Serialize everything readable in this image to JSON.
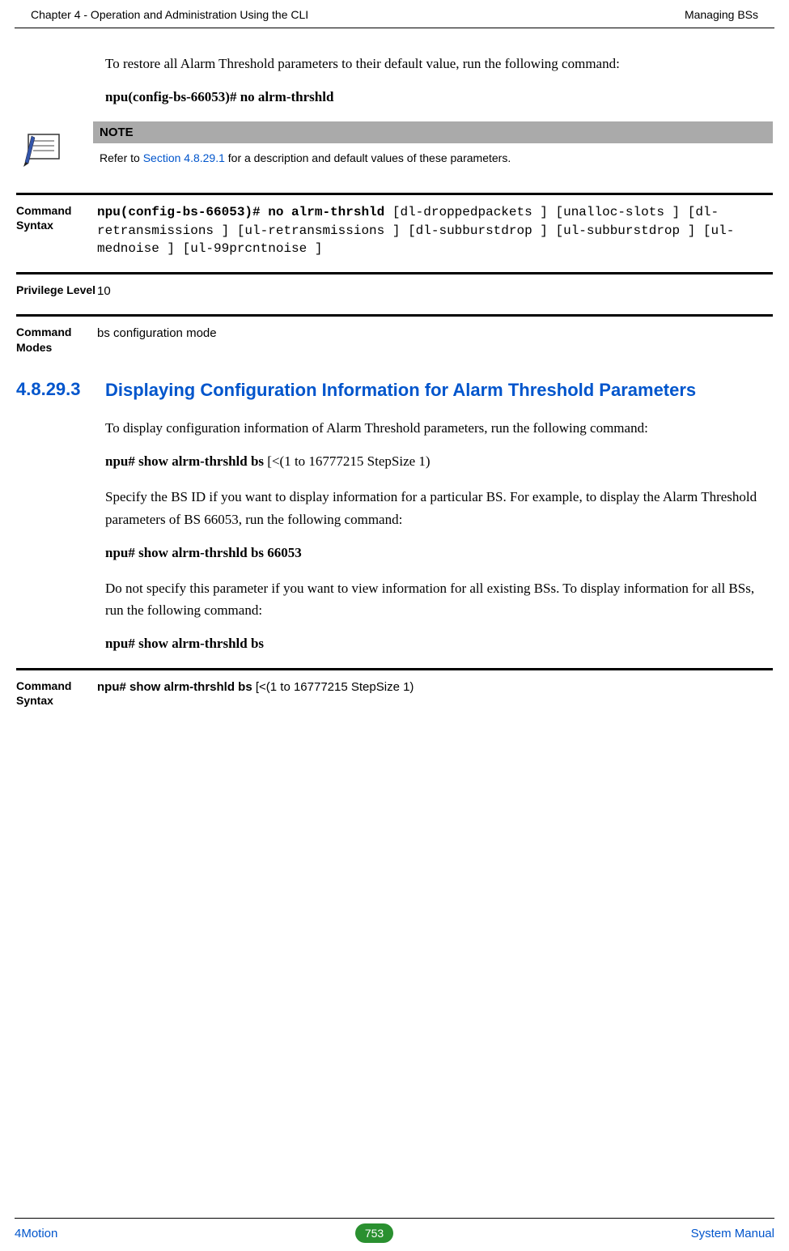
{
  "header": {
    "left": "Chapter 4 - Operation and Administration Using the CLI",
    "right": "Managing BSs"
  },
  "intro": {
    "text": "To restore all Alarm Threshold parameters to their default value, run the following command:",
    "command": "npu(config-bs-66053)# no alrm-thrshld"
  },
  "note": {
    "label": "NOTE",
    "prefix": "Refer to ",
    "link": "Section 4.8.29.1",
    "suffix": " for a description and default values of these parameters."
  },
  "row1": {
    "label": "Command Syntax",
    "bold": "npu(config-bs-66053)# no alrm-thrshld",
    "rest": " [dl-droppedpackets ] [unalloc-slots ] [dl-retransmissions ] [ul-retransmissions ] [dl-subburstdrop ] [ul-subburstdrop ] [ul-mednoise ] [ul-99prcntnoise ]"
  },
  "row2": {
    "label": "Privilege Level",
    "value": "10"
  },
  "row3": {
    "label": "Command Modes",
    "value": "bs configuration mode"
  },
  "section": {
    "num": "4.8.29.3",
    "title": "Displaying Configuration Information for Alarm Threshold Parameters"
  },
  "body": {
    "p1": "To display configuration information of Alarm Threshold parameters, run the following command:",
    "cmd1_bold": "npu# show alrm-thrshld bs",
    "cmd1_rest": " [<(1 to 16777215 StepSize 1)",
    "p2": "Specify the BS ID if you want to display information for a particular BS. For example, to display the Alarm Threshold parameters of BS 66053, run the following command:",
    "cmd2": "npu# show alrm-thrshld bs 66053",
    "p3": "Do not specify this parameter if you want to view information for all existing BSs. To display information for all BSs, run the following command:",
    "cmd3": "npu# show alrm-thrshld bs"
  },
  "row4": {
    "label": "Command Syntax",
    "bold": "npu# show alrm-thrshld bs",
    "rest": " [<(1 to 16777215 StepSize 1)"
  },
  "footer": {
    "left": "4Motion",
    "page": "753",
    "right": "System Manual"
  }
}
